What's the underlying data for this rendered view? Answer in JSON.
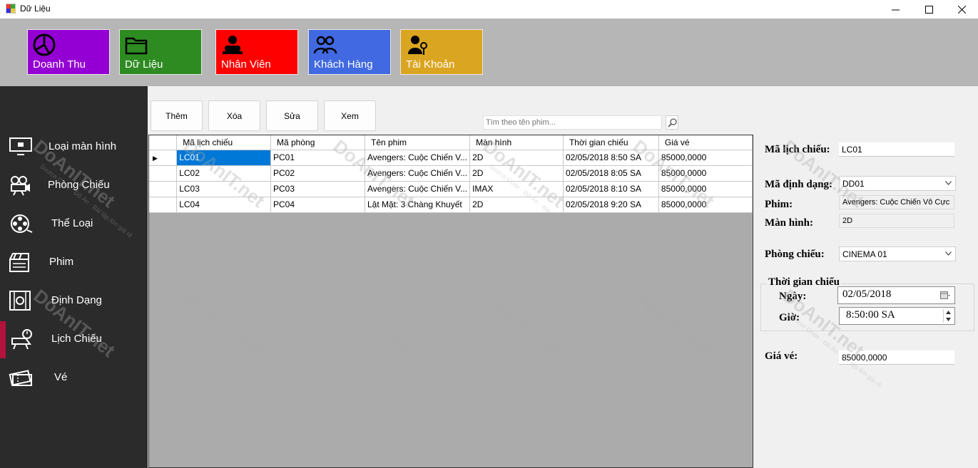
{
  "window": {
    "title": "Dữ Liệu",
    "minimize_glyph": "—",
    "maximize_glyph": "☐",
    "close_glyph": "✕"
  },
  "tiles": [
    {
      "label": "Doanh Thu",
      "icon": "pie-chart-icon",
      "color": "#9400d3"
    },
    {
      "label": "Dữ Liệu",
      "icon": "folder-icon",
      "color": "#2e8b22"
    },
    {
      "label": "Nhân Viên",
      "icon": "employee-icon",
      "color": "#ff0000"
    },
    {
      "label": "Khách Hàng",
      "icon": "customers-icon",
      "color": "#4169e1"
    },
    {
      "label": "Tài Khoản",
      "icon": "account-icon",
      "color": "#daa520"
    }
  ],
  "sidebar": {
    "accent_color": "#b3123d",
    "items": [
      {
        "label": "Loại màn hình",
        "icon": "monitor-icon"
      },
      {
        "label": "Phòng Chiếu",
        "icon": "projector-icon"
      },
      {
        "label": "Thể Loại",
        "icon": "film-reel-icon"
      },
      {
        "label": "Phim",
        "icon": "clapperboard-icon"
      },
      {
        "label": "Định Dạng",
        "icon": "film-strip-icon"
      },
      {
        "label": "Lịch Chiếu",
        "icon": "schedule-icon",
        "active": true
      },
      {
        "label": "Vé",
        "icon": "ticket-icon"
      }
    ]
  },
  "toolbar": {
    "add_label": "Thêm",
    "delete_label": "Xóa",
    "edit_label": "Sửa",
    "view_label": "Xem",
    "search_placeholder": "Tìm theo tên phim...",
    "search_icon": "magnifier-icon"
  },
  "grid": {
    "columns": [
      "Mã lịch chiếu",
      "Mã phòng",
      "Tên phim",
      "Màn hình",
      "Thời gian chiếu",
      "Giá vé"
    ],
    "rows": [
      [
        "LC01",
        "PC01",
        "Avengers: Cuộc Chiến V...",
        "2D",
        "02/05/2018 8:50 SA",
        "85000,0000"
      ],
      [
        "LC02",
        "PC02",
        "Avengers: Cuộc Chiến V...",
        "2D",
        "02/05/2018 8:05 SA",
        "85000,0000"
      ],
      [
        "LC03",
        "PC03",
        "Avengers: Cuộc Chiến V...",
        "IMAX",
        "02/05/2018 8:10 SA",
        "85000,0000"
      ],
      [
        "LC04",
        "PC04",
        "Lật Mặt: 3 Chàng Khuyết",
        "2D",
        "02/05/2018 9:20 SA",
        "85000,0000"
      ]
    ],
    "current_row_marker": "▶",
    "selection_color": "#0078d7"
  },
  "details": {
    "schedule_id_label": "Mã lịch chiếu:",
    "schedule_id_value": "LC01",
    "format_id_label": "Mã định dạng:",
    "format_id_value": "DD01",
    "movie_label": "Phim:",
    "movie_value": "Avengers: Cuộc Chiến Vô Cực",
    "screen_label": "Màn hình:",
    "screen_value": "2D",
    "room_label": "Phòng chiếu:",
    "room_value": "CINEMA 01",
    "time_group_label": "Thời gian chiếu",
    "date_label": "Ngày:",
    "date_value": "02/05/2018",
    "time_label": "Giờ:",
    "time_value": "8:50:00 SA",
    "price_label": "Giá vé:",
    "price_value": "85000,0000",
    "dropdown_glyph": "⌄"
  },
  "watermark": {
    "text": "DoAnIT.net",
    "subtext": "Source Code · Đồ Án · Bài tập lớn giá rẻ"
  }
}
